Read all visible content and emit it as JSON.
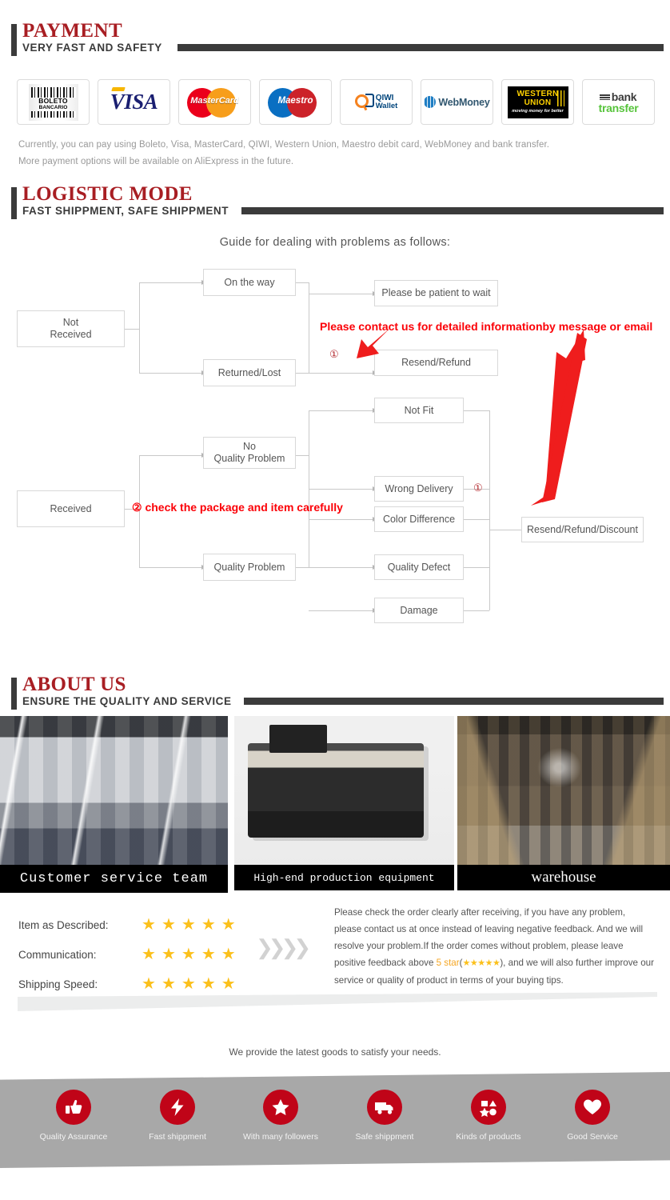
{
  "sections": {
    "payment": {
      "title": "PAYMENT",
      "subtitle": "VERY FAST AND SAFETY"
    },
    "logistic": {
      "title": "LOGISTIC MODE",
      "subtitle": "FAST SHIPPMENT, SAFE SHIPPMENT"
    },
    "about": {
      "title": "ABOUT US",
      "subtitle": "ENSURE THE QUALITY AND SERVICE"
    }
  },
  "payment": {
    "methods": [
      {
        "name": "boleto-bancario-logo",
        "line1": "BOLETO",
        "line2": "BANCARIO"
      },
      {
        "name": "visa-logo",
        "text": "VISA"
      },
      {
        "name": "mastercard-logo",
        "text": "MasterCard"
      },
      {
        "name": "maestro-logo",
        "text": "Maestro"
      },
      {
        "name": "qiwi-wallet-logo",
        "line1": "QIWI",
        "line2": "Wallet"
      },
      {
        "name": "webmoney-logo",
        "text": "WebMoney"
      },
      {
        "name": "western-union-logo",
        "line1": "WESTERN",
        "line2": "UNION",
        "line3": "moving money for better"
      },
      {
        "name": "bank-transfer-logo",
        "line1": "bank",
        "line2": "transfer"
      }
    ],
    "note_line1": "Currently, you can pay using Boleto, Visa, MasterCard, QIWI, Western Union, Maestro debit card, WebMoney and bank transfer.",
    "note_line2": "More payment options will be available on AliExpress in the future."
  },
  "flowchart": {
    "title": "Guide for dealing with problems as follows:",
    "boxes": {
      "not_received": "Not\nReceived",
      "on_the_way": "On the way",
      "returned_lost": "Returned/Lost",
      "please_wait": "Please be patient to wait",
      "resend_refund": "Resend/Refund",
      "received": "Received",
      "no_quality_problem": "No\nQuality Problem",
      "quality_problem": "Quality Problem",
      "not_fit": "Not Fit",
      "wrong_delivery": "Wrong Delivery",
      "color_difference": "Color Difference",
      "quality_defect": "Quality Defect",
      "damage": "Damage",
      "resend_refund_discount": "Resend/Refund/Discount"
    },
    "annotations": {
      "contact_note": "Please contact us for detailed informationby message or email",
      "check_note": "check the package and item carefully",
      "marker_one": "①",
      "marker_two": "②"
    }
  },
  "about": {
    "photos": [
      {
        "name": "customer-service-team-photo",
        "caption": "Customer service team"
      },
      {
        "name": "production-equipment-photo",
        "caption": "High-end production equipment"
      },
      {
        "name": "warehouse-photo",
        "caption": "warehouse"
      }
    ]
  },
  "ratings": {
    "rows": [
      {
        "label": "Item as Described:",
        "stars": 5
      },
      {
        "label": "Communication:",
        "stars": 5
      },
      {
        "label": "Shipping Speed:",
        "stars": 5
      }
    ],
    "feedback": {
      "part1": "Please check the order clearly after receiving, if you have any problem, please contact us at once instead of leaving negative feedback. And we will resolve your problem.If the order comes without problem, please leave positive feedback above ",
      "highlight": "5 star",
      "part2": "(",
      "stars": "★★★★★",
      "part3": "), and we will also further improve our service or quality of product in terms of your buying tips."
    }
  },
  "footer": {
    "tagline": "We provide the latest goods to satisfy your needs.",
    "features": [
      {
        "icon": "thumbs-up-icon",
        "label": "Quality Assurance",
        "glyph": "👍"
      },
      {
        "icon": "lightning-bolt-icon",
        "label": "Fast shippment",
        "glyph": "⚡"
      },
      {
        "icon": "star-icon",
        "label": "With many followers",
        "glyph": "★"
      },
      {
        "icon": "truck-icon",
        "label": "Safe shippment",
        "glyph": "🚚"
      },
      {
        "icon": "shapes-icon",
        "label": "Kinds of products",
        "glyph": "◼"
      },
      {
        "icon": "heart-icon",
        "label": "Good Service",
        "glyph": "♥"
      }
    ]
  },
  "colors": {
    "accent_red": "#a81e23",
    "alert_red": "#fb0007",
    "star_yellow": "#fbc01b",
    "banner_gray": "#a8a8a8",
    "icon_red": "#c00418"
  }
}
